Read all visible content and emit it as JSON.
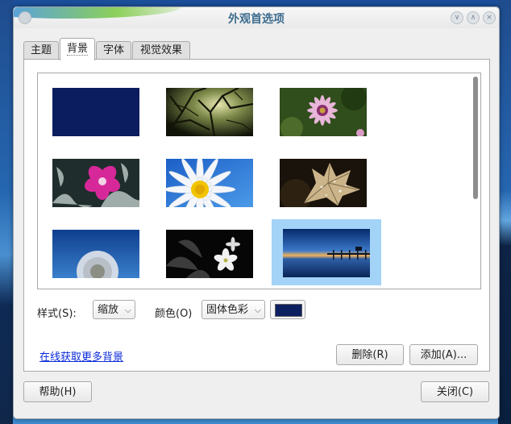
{
  "window": {
    "title": "外观首选项"
  },
  "tabs": [
    {
      "label": "主题"
    },
    {
      "label": "背景"
    },
    {
      "label": "字体"
    },
    {
      "label": "视觉效果"
    }
  ],
  "gallery": {
    "selected_index": 8,
    "thumbnails": [
      {
        "name": "solid-dark-blue"
      },
      {
        "name": "tree-canopy"
      },
      {
        "name": "pink-daisy"
      },
      {
        "name": "pink-flower-frost"
      },
      {
        "name": "white-daisy-blue-sky"
      },
      {
        "name": "autumn-leaf-raindrops"
      },
      {
        "name": "dandelion"
      },
      {
        "name": "white-flowers-dark"
      },
      {
        "name": "pier-at-dusk"
      }
    ]
  },
  "style": {
    "label": "样式(S):",
    "value": "缩放"
  },
  "color": {
    "label": "颜色(O)",
    "value": "固体色彩",
    "swatch": "#0c1f5f"
  },
  "more_link": "在线获取更多背景",
  "buttons": {
    "delete": "删除(R)",
    "add": "添加(A)...",
    "help": "帮助(H)",
    "close": "关闭(C)"
  },
  "window_controls": {
    "minimize": "∨",
    "maximize": "∧",
    "close": "×"
  }
}
